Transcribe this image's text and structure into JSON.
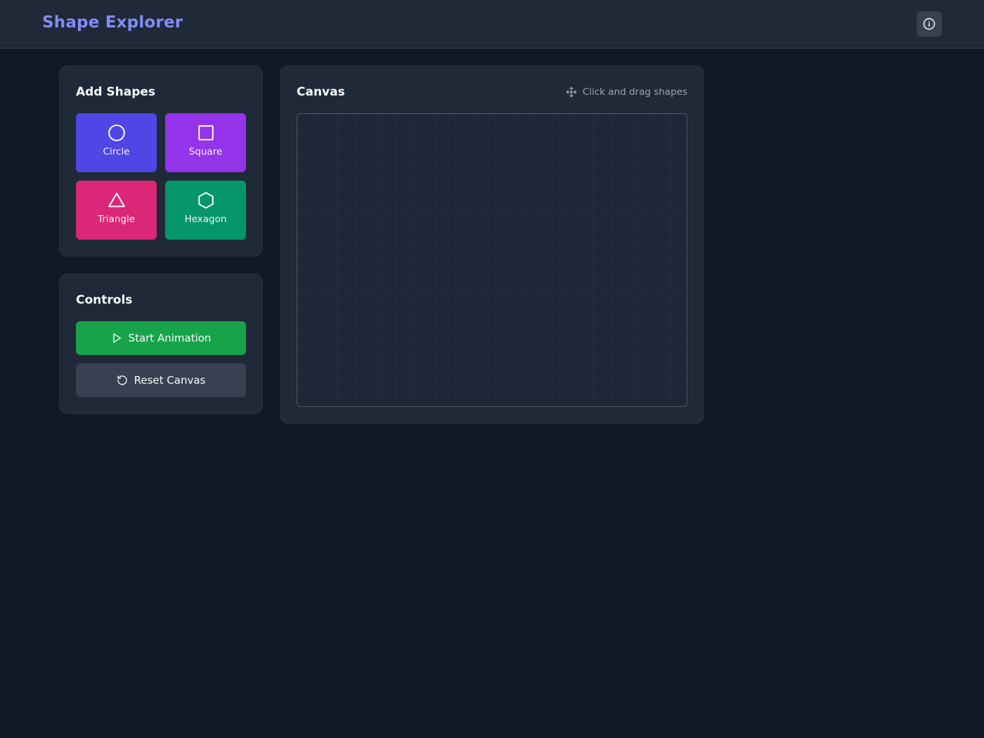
{
  "app": {
    "title": "Shape Explorer"
  },
  "header": {
    "info_icon": "info-icon"
  },
  "add_shapes": {
    "title": "Add Shapes",
    "buttons": [
      {
        "label": "Circle",
        "icon": "circle-icon",
        "color": "#4f46e5"
      },
      {
        "label": "Square",
        "icon": "square-icon",
        "color": "#9333ea"
      },
      {
        "label": "Triangle",
        "icon": "triangle-icon",
        "color": "#db2777"
      },
      {
        "label": "Hexagon",
        "icon": "hexagon-icon",
        "color": "#059669"
      }
    ]
  },
  "controls": {
    "title": "Controls",
    "start_label": "Start Animation",
    "start_color": "#16a34a",
    "reset_label": "Reset Canvas",
    "reset_color": "#374151"
  },
  "canvas": {
    "title": "Canvas",
    "hint": "Click and drag shapes",
    "hint_icon": "move-icon"
  },
  "colors": {
    "background": "#111827",
    "surface": "#1f2937",
    "accent": "#818cf8"
  }
}
